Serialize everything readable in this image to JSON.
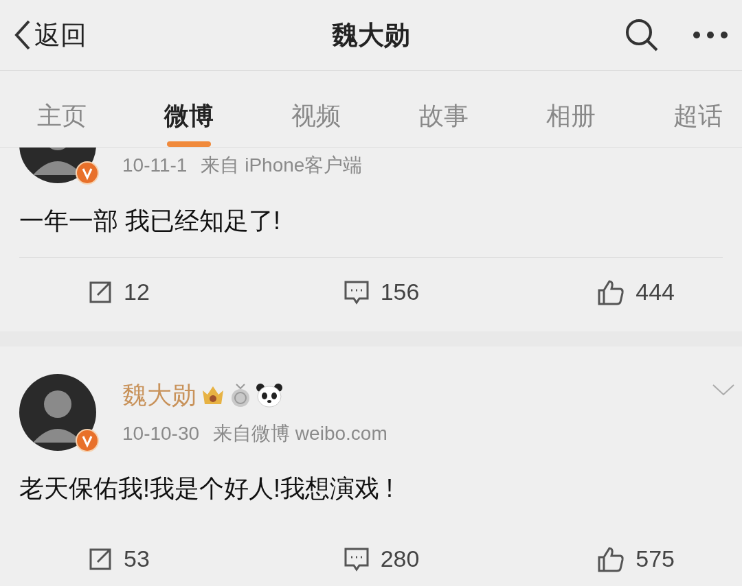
{
  "header": {
    "back_label": "返回",
    "title": "魏大勋"
  },
  "tabs": [
    {
      "label": "主页",
      "selected": false
    },
    {
      "label": "微博",
      "selected": true
    },
    {
      "label": "视频",
      "selected": false
    },
    {
      "label": "故事",
      "selected": false
    },
    {
      "label": "相册",
      "selected": false
    },
    {
      "label": "超话",
      "selected": false
    }
  ],
  "posts": [
    {
      "date": "10-11-1",
      "source": "来自 iPhone客户端",
      "verified": true,
      "text": "一年一部 我已经知足了!",
      "reposts": "12",
      "comments": "156",
      "likes": "444"
    },
    {
      "author": "魏大勋",
      "date": "10-10-30",
      "source": "来自微博 weibo.com",
      "verified": true,
      "text": "老天保佑我!我是个好人!我想演戏 !",
      "reposts": "53",
      "comments": "280",
      "likes": "575"
    }
  ]
}
